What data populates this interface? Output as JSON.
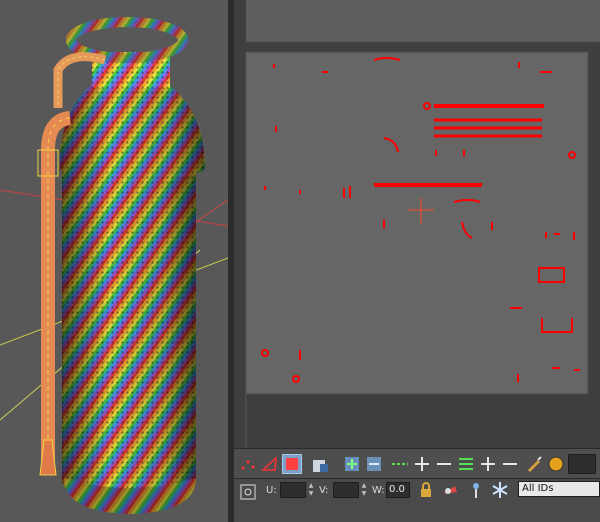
{
  "viewport": {
    "object": "fire-extinguisher-mesh",
    "view": "perspective"
  },
  "uv_editor": {
    "background": "#666666",
    "uv_color": "#ff0000",
    "grid_color": "#4a4a4a"
  },
  "toolbar_row1": {
    "buttons": [
      "vertex-icon",
      "edge-icon",
      "face-icon",
      "element-icon",
      "grow-icon",
      "shrink-icon",
      "ring-icon",
      "ring-grow-icon",
      "ring-shrink-icon",
      "loop-icon",
      "loop-grow-icon",
      "loop-shrink-icon",
      "paint-select-icon",
      "render-icon"
    ],
    "selected": "face-icon"
  },
  "toolbar_row2": {
    "u_label": "U:",
    "v_label": "V:",
    "w_label": "W:",
    "w_value": "0.0",
    "u_value": "",
    "v_value": "",
    "id_filter": "All IDs"
  }
}
